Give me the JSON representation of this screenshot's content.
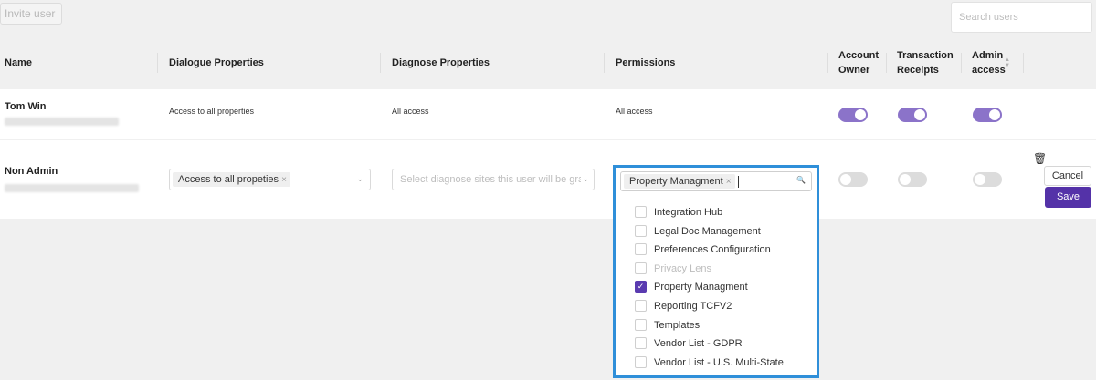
{
  "toolbar": {
    "invite_label": "Invite user",
    "search_placeholder": "Search users"
  },
  "table": {
    "headers": {
      "name": "Name",
      "dialogue": "Dialogue Properties",
      "diagnose": "Diagnose Properties",
      "permissions": "Permissions",
      "account_owner": "Account Owner",
      "transaction_receipts": "Transaction Receipts",
      "admin_access": "Admin access"
    },
    "rows": [
      {
        "name": "Tom Win",
        "dialogue": "Access to all properties",
        "diagnose": "All access",
        "permissions": "All access",
        "account_owner": true,
        "transaction_receipts": true,
        "admin_access": true
      },
      {
        "name": "Non Admin",
        "dialogue_tag": "Access to all propeties",
        "diagnose_placeholder": "Select diagnose sites this user will be gra...",
        "permissions_tag": "Property Managment",
        "account_owner": false,
        "transaction_receipts": false,
        "admin_access": false
      }
    ]
  },
  "permissions_dropdown": {
    "options": [
      {
        "label": "Integration Hub",
        "checked": false,
        "disabled": false
      },
      {
        "label": "Legal Doc Management",
        "checked": false,
        "disabled": false
      },
      {
        "label": "Preferences Configuration",
        "checked": false,
        "disabled": false
      },
      {
        "label": "Privacy Lens",
        "checked": false,
        "disabled": true
      },
      {
        "label": "Property Managment",
        "checked": true,
        "disabled": false
      },
      {
        "label": "Reporting TCFV2",
        "checked": false,
        "disabled": false
      },
      {
        "label": "Templates",
        "checked": false,
        "disabled": false
      },
      {
        "label": "Vendor List - GDPR",
        "checked": false,
        "disabled": false
      },
      {
        "label": "Vendor List - U.S. Multi-State",
        "checked": false,
        "disabled": false
      }
    ]
  },
  "actions": {
    "cancel_label": "Cancel",
    "save_label": "Save"
  },
  "colors": {
    "accent": "#5432a8",
    "toggle_on": "#8b73c9",
    "focus_outline": "#2f8fd9"
  }
}
